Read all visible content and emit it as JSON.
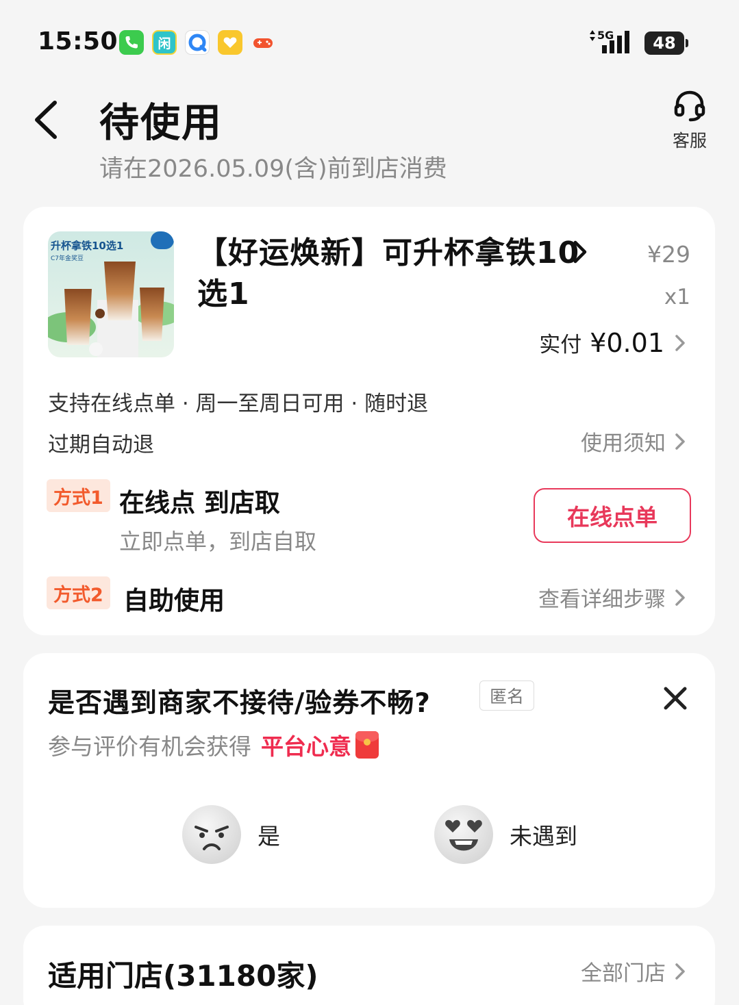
{
  "status_bar": {
    "time": "15:50",
    "network": "5G",
    "battery": "48",
    "apps": [
      "phone-icon",
      "xianyu-icon",
      "browser-icon",
      "heart-app-icon",
      "game-icon"
    ]
  },
  "header": {
    "title": "待使用",
    "subtitle": "请在2026.05.09(含)前到店消费",
    "service_label": "客服"
  },
  "product": {
    "name": "【好运焕新】可升杯拿铁10选1",
    "price": "¥29",
    "quantity": "x1",
    "paid_label": "实付",
    "paid_value": "¥0.01",
    "thumb_text": "升杯拿铁10选1",
    "thumb_sub": "C7年金奖豆",
    "features": "支持在线点单 · 周一至周日可用 · 随时退",
    "expiry_note": "过期自动退",
    "notice_label": "使用须知"
  },
  "methods": [
    {
      "tag": "方式1",
      "title": "在线点 到店取",
      "desc": "立即点单，到店自取",
      "button": "在线点单"
    },
    {
      "tag": "方式2",
      "title": "自助使用",
      "link": "查看详细步骤"
    }
  ],
  "survey": {
    "question": "是否遇到商家不接待/验券不畅?",
    "anonymous": "匿名",
    "reward_prefix": "参与评价有机会获得",
    "reward_em": "平台心意",
    "yes_label": "是",
    "no_label": "未遇到"
  },
  "stores": {
    "title": "适用门店(31180家)",
    "all_label": "全部门店"
  },
  "colors": {
    "accent": "#e8385a",
    "tag_bg": "#fde7dd",
    "tag_text": "#f25a2c",
    "background": "#f5f5f5"
  }
}
